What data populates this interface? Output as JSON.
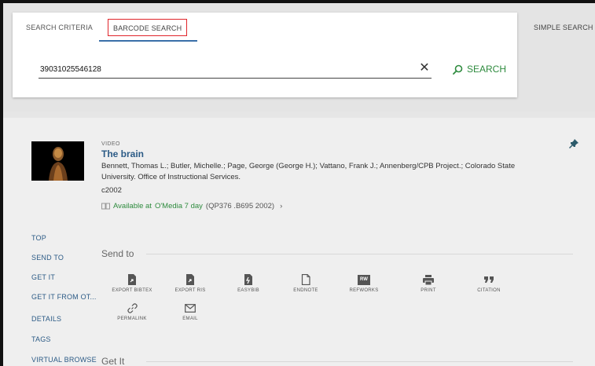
{
  "search": {
    "tab_criteria": "SEARCH CRITERIA",
    "tab_barcode": "BARCODE SEARCH",
    "query": "39031025546128",
    "search_label": "SEARCH",
    "simple_search": "SIMPLE SEARCH"
  },
  "record": {
    "type": "VIDEO",
    "title": "The brain",
    "authors": "Bennett, Thomas L.; Butler, Michelle.; Page, George (George H.); Vattano, Frank J.; Annenberg/CPB Project.; Colorado State University. Office of Instructional Services.",
    "date": "c2002",
    "availability_status": "Available at",
    "availability_location": "O'Media 7 day",
    "availability_callno": "(QP376 .B695 2002)"
  },
  "nav": {
    "items": [
      "TOP",
      "SEND TO",
      "GET IT",
      "GET IT FROM OT...",
      "DETAILS",
      "TAGS",
      "VIRTUAL BROWSE"
    ]
  },
  "sections": {
    "send_to": "Send to",
    "get_it": "Get It"
  },
  "actions": [
    {
      "label": "EXPORT BIBTEX",
      "icon": "file-export-icon"
    },
    {
      "label": "EXPORT RIS",
      "icon": "file-export-icon"
    },
    {
      "label": "EASYBIB",
      "icon": "file-export-icon"
    },
    {
      "label": "ENDNOTE",
      "icon": "endnote-icon"
    },
    {
      "label": "REFWORKS",
      "icon": "refworks-icon"
    },
    {
      "label": "PRINT",
      "icon": "print-icon"
    },
    {
      "label": "CITATION",
      "icon": "quote-icon"
    },
    {
      "label": "PERMALINK",
      "icon": "link-icon"
    },
    {
      "label": "EMAIL",
      "icon": "email-icon"
    }
  ],
  "refworks_abbrev": "RW",
  "colors": {
    "accent_green": "#2e8b3e",
    "link_blue": "#2c5b86",
    "highlight_red": "#e0252b"
  }
}
